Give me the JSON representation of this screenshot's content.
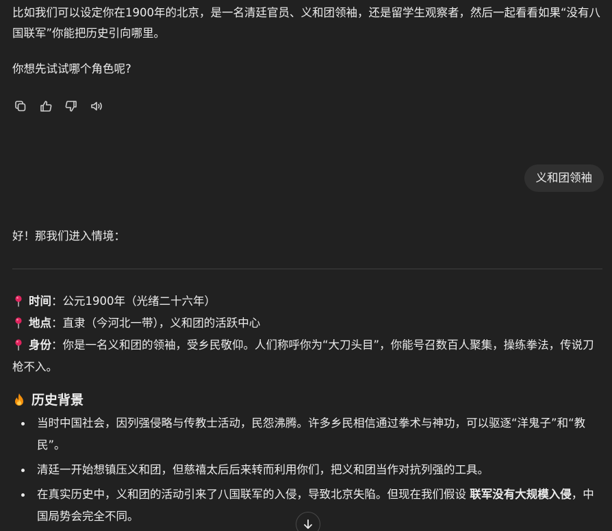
{
  "assistant_intro": {
    "para1": "比如我们可以设定你在1900年的北京，是一名清廷官员、义和团领袖，还是留学生观察者，然后一起看看如果“没有八国联军”你能把历史引向哪里。",
    "para2": "你想先试试哪个角色呢?"
  },
  "actions": {
    "icons": [
      "copy-icon",
      "thumbs-up-icon",
      "thumbs-down-icon",
      "speaker-icon"
    ]
  },
  "user_message": "义和团领袖",
  "assistant_reply": {
    "opening": "好！那我们进入情境：",
    "time_label": "时间",
    "time_value": "：公元1900年（光绪二十六年）",
    "place_label": "地点",
    "place_value": "：直隶（今河北一带），义和团的活跃中心",
    "role_label": "身份",
    "role_value": "：你是一名义和团的领袖，受乡民敬仰。人们称呼你为“大刀头目”，你能号召数百人聚集，操练拳法，传说刀枪不入。",
    "section_heading": "历史背景",
    "bullets": [
      {
        "text": "当时中国社会，因列强侵略与传教士活动，民怨沸腾。许多乡民相信通过拳术与神功，可以驱逐“洋鬼子”和“教民”。"
      },
      {
        "text": "清廷一开始想镇压义和团，但慈禧太后后来转而利用你们，把义和团当作对抗列强的工具。"
      },
      {
        "pre": "在真实历史中，义和团的活动引来了八国联军的入侵，导致北京失陷。但现在我们假设 ",
        "bold": "联军没有大规模入侵",
        "post": "，中国局势会完全不同。"
      }
    ]
  },
  "colors": {
    "background": "#212121",
    "text": "#ececec",
    "bubble": "#303030",
    "pin": "#e0245e",
    "fire": "#f4900c"
  }
}
